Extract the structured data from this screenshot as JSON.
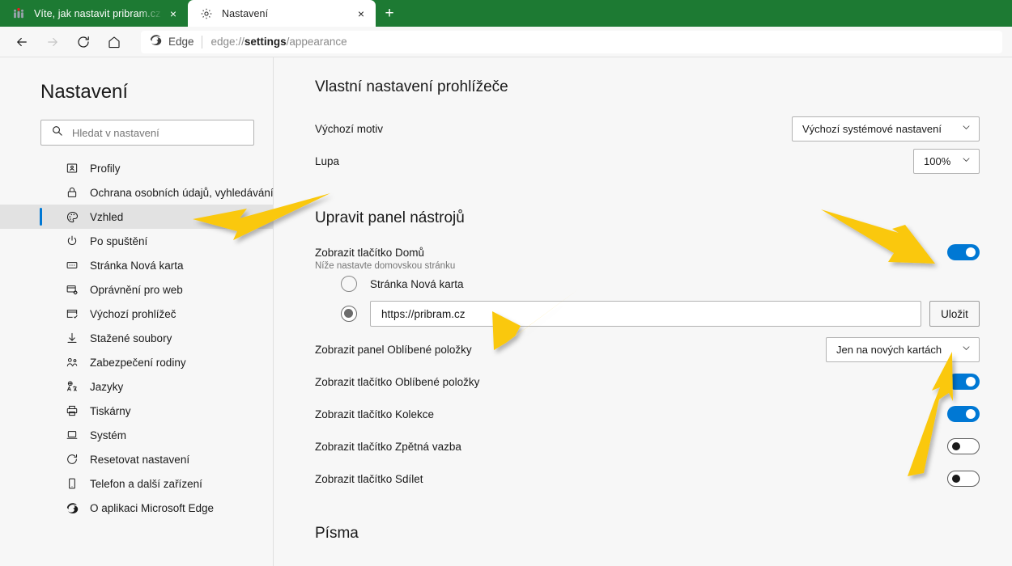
{
  "window": {
    "tabs": [
      {
        "title": "Víte, jak nastavit pribram.cz jako",
        "favicon": "people-favicon",
        "active": false,
        "close_label": "×"
      },
      {
        "title": "Nastavení",
        "favicon": "gear-favicon",
        "active": true,
        "close_label": "×"
      }
    ],
    "new_tab_label": "+",
    "tabstrip_color": "#1d7a33"
  },
  "toolbar": {
    "back_label": "back-arrow",
    "forward_label": "forward-arrow",
    "refresh_label": "refresh-arrow",
    "home_label": "home-house",
    "omnibox": {
      "brand": "Edge",
      "url_prefix": "edge://",
      "url_bold": "settings",
      "url_suffix": "/appearance",
      "full_url": "edge://settings/appearance"
    }
  },
  "sidebar": {
    "title": "Nastavení",
    "search": {
      "placeholder": "Hledat v nastavení",
      "value": ""
    },
    "items": [
      {
        "label": "Profily",
        "icon": "profile-card-icon",
        "selected": false
      },
      {
        "label": "Ochrana osobních údajů, vyhledávání",
        "icon": "lock-icon",
        "selected": false
      },
      {
        "label": "Vzhled",
        "icon": "palette-icon",
        "selected": true
      },
      {
        "label": "Po spuštění",
        "icon": "power-icon",
        "selected": false
      },
      {
        "label": "Stránka Nová karta",
        "icon": "new-tab-page-icon",
        "selected": false
      },
      {
        "label": "Oprávnění pro web",
        "icon": "site-permissions-icon",
        "selected": false
      },
      {
        "label": "Výchozí prohlížeč",
        "icon": "default-browser-icon",
        "selected": false
      },
      {
        "label": "Stažené soubory",
        "icon": "download-icon",
        "selected": false
      },
      {
        "label": "Zabezpečení rodiny",
        "icon": "family-icon",
        "selected": false
      },
      {
        "label": "Jazyky",
        "icon": "languages-icon",
        "selected": false
      },
      {
        "label": "Tiskárny",
        "icon": "printer-icon",
        "selected": false
      },
      {
        "label": "Systém",
        "icon": "laptop-icon",
        "selected": false
      },
      {
        "label": "Resetovat nastavení",
        "icon": "reset-icon",
        "selected": false
      },
      {
        "label": "Telefon a další zařízení",
        "icon": "phone-icon",
        "selected": false
      },
      {
        "label": "O aplikaci Microsoft Edge",
        "icon": "edge-logo-icon",
        "selected": false
      }
    ]
  },
  "main": {
    "section_browser": {
      "heading": "Vlastní nastavení prohlížeče",
      "theme": {
        "label": "Výchozí motiv",
        "value": "Výchozí systémové nastavení"
      },
      "zoom": {
        "label": "Lupa",
        "value": "100%"
      }
    },
    "section_toolbar": {
      "heading": "Upravit panel nástrojů",
      "home_button": {
        "label": "Zobrazit tlačítko Domů",
        "sub": "Níže nastavte domovskou stránku",
        "state": "on"
      },
      "home_radio_newtab": {
        "label": "Stránka Nová karta",
        "checked": false
      },
      "home_radio_url": {
        "checked": true,
        "value": "https://pribram.cz",
        "save_label": "Uložit"
      },
      "rows": [
        {
          "label": "Zobrazit panel Oblíbené položky",
          "control": "dropdown",
          "value": "Jen na nových kartách"
        },
        {
          "label": "Zobrazit tlačítko Oblíbené položky",
          "control": "toggle",
          "state": "on"
        },
        {
          "label": "Zobrazit tlačítko Kolekce",
          "control": "toggle",
          "state": "on"
        },
        {
          "label": "Zobrazit tlačítko Zpětná vazba",
          "control": "toggle",
          "state": "off"
        },
        {
          "label": "Zobrazit tlačítko Sdílet",
          "control": "toggle",
          "state": "off"
        }
      ]
    },
    "section_fonts": {
      "heading": "Písma"
    }
  },
  "annotations": {
    "arrow_color": "#FAC80F",
    "arrows": [
      {
        "name": "arrow-to-vzhled",
        "points_to": "sidebar-item-vzhled"
      },
      {
        "name": "arrow-to-home-toggle",
        "points_to": "home-button-toggle"
      },
      {
        "name": "arrow-to-url-field",
        "points_to": "home-url-input"
      },
      {
        "name": "arrow-to-save-button",
        "points_to": "save-button"
      }
    ]
  }
}
